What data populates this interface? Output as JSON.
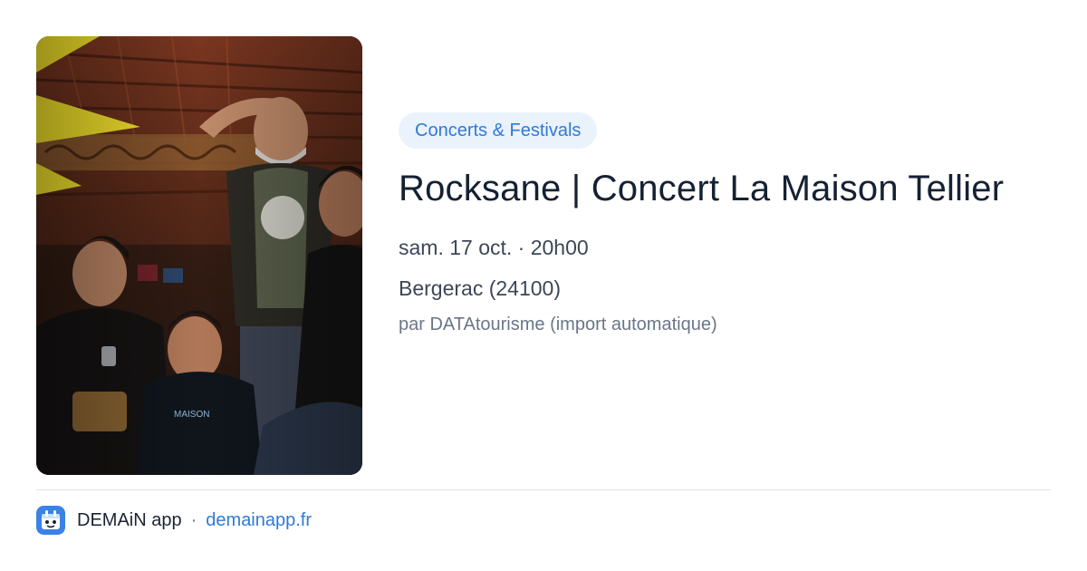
{
  "event": {
    "category": "Concerts & Festivals",
    "title": "Rocksane | Concert La Maison Tellier",
    "datetime": "sam. 17 oct. · 20h00",
    "location": "Bergerac (24100)",
    "source": "par DATAtourisme (import automatique)",
    "image_icon": "band-photo"
  },
  "footer": {
    "app_name": "DEMAiN app",
    "separator": "·",
    "domain": "demainapp.fr",
    "logo_icon": "demain-app-icon"
  },
  "colors": {
    "accent": "#2f7ad8",
    "pill_background": "#eaf2fc",
    "title_text": "#152133",
    "secondary_text": "#3c4757",
    "muted_text": "#6a7687",
    "divider": "#dde4ea",
    "logo_blue": "#3b82e6"
  }
}
